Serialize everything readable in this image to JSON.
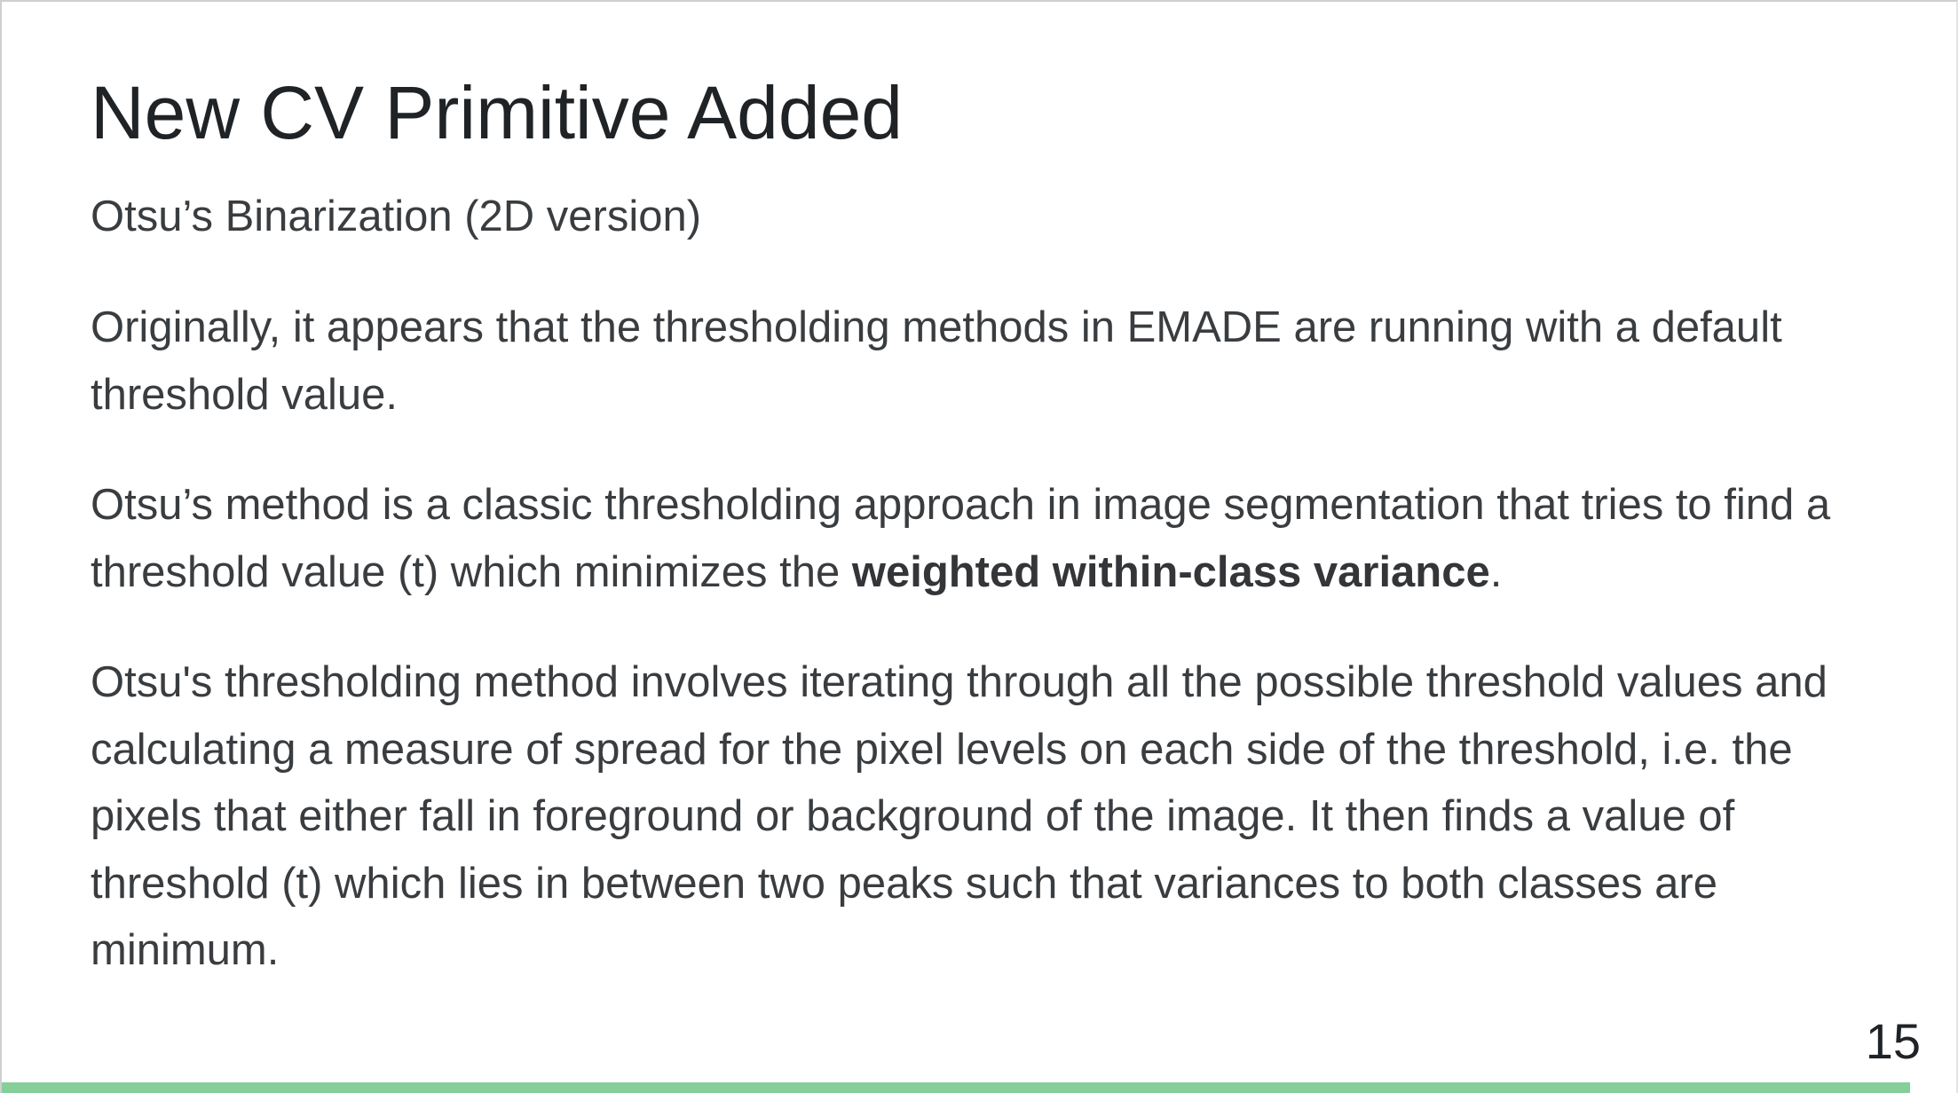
{
  "slide": {
    "title": "New CV Primitive Added",
    "subtitle": "Otsu’s Binarization (2D version)",
    "paragraph1": "Originally, it appears that the thresholding methods in EMADE are running with a default threshold value.",
    "paragraph2": {
      "before": "Otsu’s method is a classic thresholding approach in image segmentation that tries to find a threshold value (t) which minimizes the ",
      "bold": "weighted within-class variance",
      "after": "."
    },
    "paragraph3": "Otsu's thresholding method involves iterating through all the possible threshold values and calculating a measure of spread for the pixel levels on each side of the threshold, i.e. the pixels that either fall in foreground or background of the image. It then finds a value of threshold (t) which lies in between two peaks such that variances to both classes are minimum.",
    "page_number": "15"
  },
  "colors": {
    "accent": "#86cf9b",
    "text": "#3a3d40",
    "title": "#202326"
  }
}
